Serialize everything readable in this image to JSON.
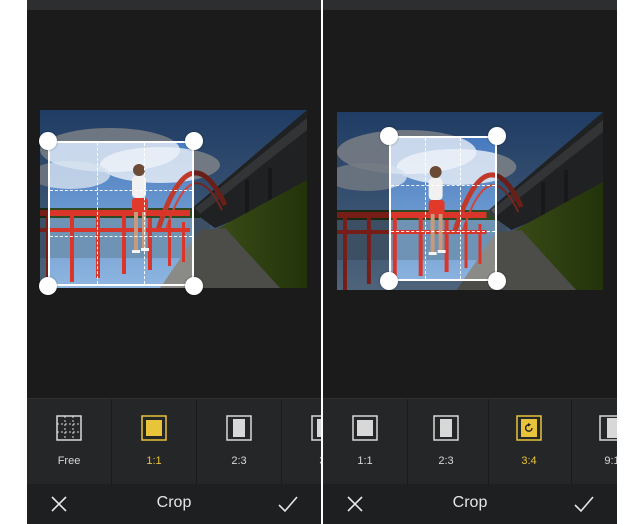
{
  "left_screen": {
    "ratios": [
      {
        "label": "Free",
        "icon": "free-grid-icon",
        "active": false
      },
      {
        "label": "1:1",
        "icon": "ratio-1-1-icon",
        "active": true
      },
      {
        "label": "2:3",
        "icon": "ratio-2-3-icon",
        "active": false
      },
      {
        "label": "3:",
        "icon": "ratio-3-4-icon",
        "active": false
      }
    ],
    "title": "Crop"
  },
  "right_screen": {
    "ratios": [
      {
        "label": "1:1",
        "icon": "ratio-1-1-icon",
        "active": false
      },
      {
        "label": "2:3",
        "icon": "ratio-2-3-icon",
        "active": false
      },
      {
        "label": "3:4",
        "icon": "ratio-3-4-rotate-icon",
        "active": true
      },
      {
        "label": "9:1",
        "icon": "ratio-9-16-icon",
        "active": false
      }
    ],
    "title": "Crop"
  },
  "colors": {
    "accent": "#e8c43a",
    "background": "#1b1b1b",
    "toolbar": "#252628"
  },
  "icons": {
    "close": "close-icon",
    "confirm": "checkmark-icon"
  }
}
